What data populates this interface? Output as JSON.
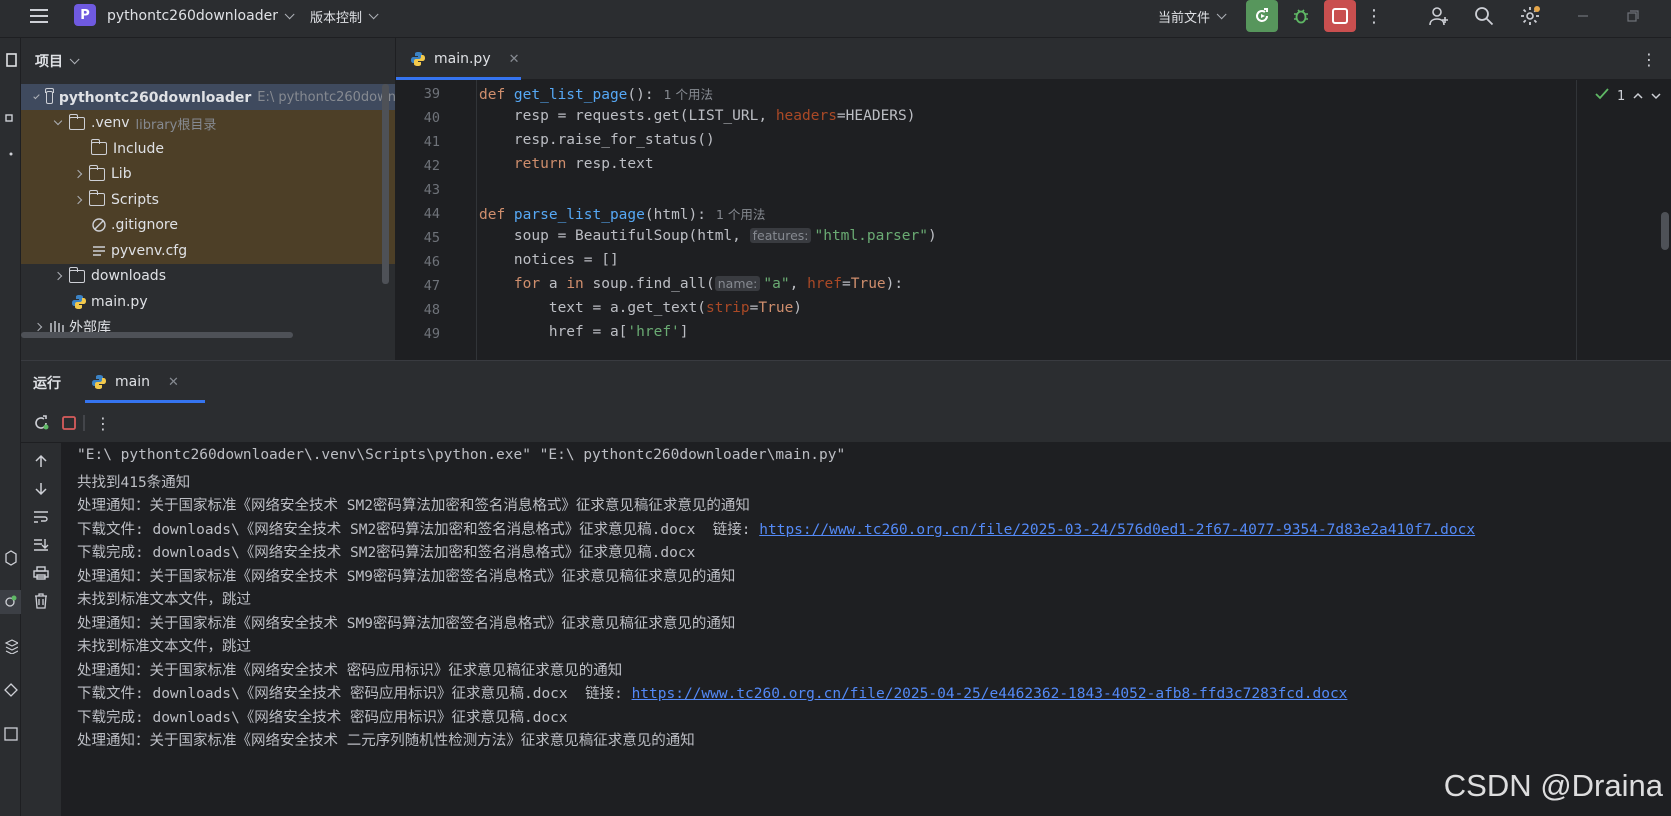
{
  "titlebar": {
    "project_badge": "P",
    "project_name": "pythontc260downloader",
    "vcs_label": "版本控制",
    "current_file_label": "当前文件"
  },
  "project": {
    "header": "项目",
    "tree": [
      {
        "label": "pythontc260downloader",
        "hint": "E:\\ pythontc260down",
        "depth": 0,
        "twisty": "open",
        "icon": "folder-icon",
        "style": "sel"
      },
      {
        "label": ".venv",
        "hint": "library根目录",
        "depth": 1,
        "twisty": "open",
        "icon": "folder-icon",
        "style": "exc"
      },
      {
        "label": "Include",
        "hint": "",
        "depth": 2,
        "twisty": "none",
        "icon": "folder-icon",
        "style": "exc"
      },
      {
        "label": "Lib",
        "hint": "",
        "depth": 2,
        "twisty": "closed",
        "icon": "folder-icon",
        "style": "exc"
      },
      {
        "label": "Scripts",
        "hint": "",
        "depth": 2,
        "twisty": "closed",
        "icon": "folder-icon",
        "style": "exc"
      },
      {
        "label": ".gitignore",
        "hint": "",
        "depth": 2,
        "twisty": "none",
        "icon": "gitignore-icon",
        "style": "exc"
      },
      {
        "label": "pyvenv.cfg",
        "hint": "",
        "depth": 2,
        "twisty": "none",
        "icon": "text-file-icon",
        "style": "exc"
      },
      {
        "label": "downloads",
        "hint": "",
        "depth": 1,
        "twisty": "closed",
        "icon": "folder-icon",
        "style": ""
      },
      {
        "label": "main.py",
        "hint": "",
        "depth": 1,
        "twisty": "none",
        "icon": "python-icon",
        "style": ""
      },
      {
        "label": "外部库",
        "hint": "",
        "depth": 0,
        "twisty": "closed",
        "icon": "library-icon",
        "style": ""
      }
    ]
  },
  "editor": {
    "tab_label": "main.py",
    "inspection_count": "1",
    "line_numbers": [
      "39",
      "40",
      "41",
      "42",
      "43",
      "44",
      "45",
      "46",
      "47",
      "48",
      "49"
    ],
    "usage_hint": "1 个用法",
    "inlay_features": "features:",
    "inlay_name": "name:"
  },
  "run": {
    "title": "运行",
    "tab_label": "main",
    "console": [
      "\"E:\\ pythontc260downloader\\.venv\\Scripts\\python.exe\" \"E:\\ pythontc260downloader\\main.py\"",
      "共找到415条通知",
      "处理通知：关于国家标准《网络安全技术 SM2密码算法加密和签名消息格式》征求意见稿征求意见的通知",
      {
        "text": "下载文件: downloads\\《网络安全技术 SM2密码算法加密和签名消息格式》征求意见稿.docx  链接: ",
        "link": "https://www.tc260.org.cn/file/2025-03-24/576d0ed1-2f67-4077-9354-7d83e2a410f7.docx"
      },
      "下载完成: downloads\\《网络安全技术 SM2密码算法加密和签名消息格式》征求意见稿.docx",
      "处理通知：关于国家标准《网络安全技术 SM9密码算法加密签名消息格式》征求意见稿征求意见的通知",
      "未找到标准文本文件，跳过",
      "处理通知：关于国家标准《网络安全技术 SM9密码算法加密签名消息格式》征求意见稿征求意见的通知",
      "未找到标准文本文件，跳过",
      "处理通知：关于国家标准《网络安全技术 密码应用标识》征求意见稿征求意见的通知",
      {
        "text": "下载文件: downloads\\《网络安全技术 密码应用标识》征求意见稿.docx  链接: ",
        "link": "https://www.tc260.org.cn/file/2025-04-25/e4462362-1843-4052-afb8-ffd3c7283fcd.docx"
      },
      "下载完成: downloads\\《网络安全技术 密码应用标识》征求意见稿.docx",
      "处理通知：关于国家标准《网络安全技术 二元序列随机性检测方法》征求意见稿征求意见的通知"
    ]
  },
  "watermark": "CSDN @Draina",
  "colors": {
    "accent": "#3574f0",
    "run_green": "#57965c",
    "stop_red": "#c94f4f",
    "link": "#548af7"
  }
}
